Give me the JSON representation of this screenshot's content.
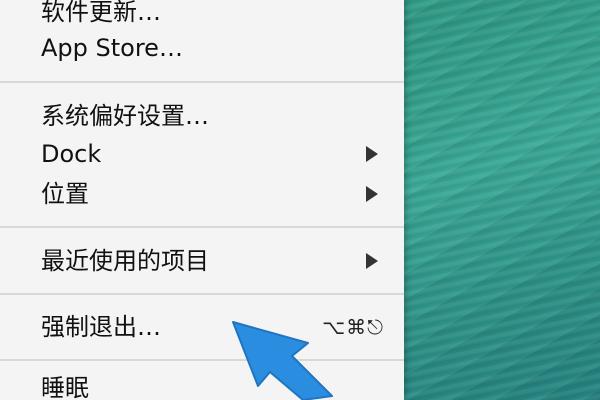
{
  "menu": {
    "software_update": "软件更新…",
    "app_store": "App Store…",
    "system_preferences": "系统偏好设置…",
    "dock": "Dock",
    "location": "位置",
    "recent_items": "最近使用的项目",
    "force_quit": "强制退出…",
    "force_quit_shortcut": "⌥⌘⎋",
    "sleep": "睡眠"
  },
  "colors": {
    "menu_background": "#f4f4f4",
    "arrow": "#2b8de0",
    "desktop": "#3a9c8c"
  },
  "icons": {
    "submenu": "triangle-right-icon",
    "pointer": "blue-arrow-icon"
  }
}
